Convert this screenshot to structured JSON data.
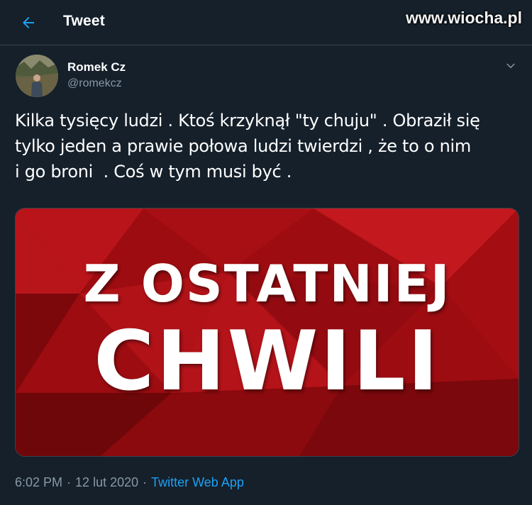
{
  "header": {
    "title": "Tweet",
    "back_icon": "arrow-left-icon",
    "watermark": "www.wiocha.pl"
  },
  "tweet": {
    "author_name": "Romek Cz",
    "author_handle": "@romekcz",
    "text": "Kilka tysięcy ludzi . Ktoś krzyknął \"ty chuju\" . Obraził się\ntylko jeden a prawie połowa ludzi twierdzi , że to o nim\ni go broni  . Coś w tym musi być .",
    "media": {
      "line1": "Z OSTATNIEJ",
      "line2": "CHWILI"
    },
    "time": "6:02 PM",
    "separator": "·",
    "date": "12 lut 2020",
    "source": "Twitter Web App"
  },
  "colors": {
    "background": "#15202b",
    "accent": "#1da1f2",
    "secondary_text": "#8899a6"
  }
}
